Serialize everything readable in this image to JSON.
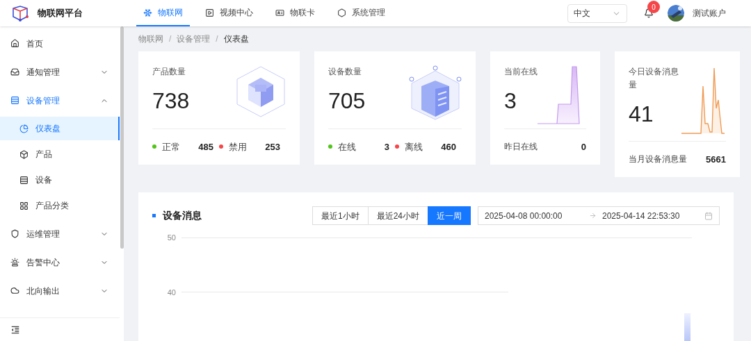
{
  "header": {
    "brand": "物联网平台",
    "nav": [
      {
        "label": "物联网",
        "selected": true
      },
      {
        "label": "视频中心",
        "selected": false
      },
      {
        "label": "物联卡",
        "selected": false
      },
      {
        "label": "系统管理",
        "selected": false
      }
    ],
    "language": "中文",
    "notification_count": "0",
    "user": "测试账户"
  },
  "sidebar": {
    "items": [
      {
        "label": "首页",
        "selected": false
      },
      {
        "label": "通知管理",
        "selected": false,
        "expanded": false
      },
      {
        "label": "设备管理",
        "selected": true,
        "expanded": true,
        "children": [
          {
            "label": "仪表盘",
            "selected": true
          },
          {
            "label": "产品",
            "selected": false
          },
          {
            "label": "设备",
            "selected": false
          },
          {
            "label": "产品分类",
            "selected": false
          }
        ]
      },
      {
        "label": "运维管理",
        "selected": false,
        "expanded": false
      },
      {
        "label": "告警中心",
        "selected": false,
        "expanded": false
      },
      {
        "label": "北向输出",
        "selected": false,
        "expanded": false
      }
    ]
  },
  "breadcrumb": {
    "separator": "/",
    "items": [
      "物联网",
      "设备管理",
      "仪表盘"
    ]
  },
  "cards": [
    {
      "kind": "status",
      "title": "产品数量",
      "value": "738",
      "stats": [
        {
          "label": "正常",
          "value": "485",
          "color": "#52c41a"
        },
        {
          "label": "禁用",
          "value": "253",
          "color": "#f5474a"
        }
      ]
    },
    {
      "kind": "status",
      "title": "设备数量",
      "value": "705",
      "stats": [
        {
          "label": "在线",
          "value": "3",
          "color": "#52c41a"
        },
        {
          "label": "离线",
          "value": "460",
          "color": "#f5474a"
        }
      ]
    },
    {
      "kind": "compare",
      "title": "当前在线",
      "value": "3",
      "footer_label": "昨日在线",
      "footer_value": "0"
    },
    {
      "kind": "compare",
      "title": "今日设备消息量",
      "value": "41",
      "footer_label": "当月设备消息量",
      "footer_value": "5661"
    }
  ],
  "messages": {
    "title": "设备消息",
    "ranges": [
      {
        "label": "最近1小时",
        "selected": false
      },
      {
        "label": "最近24小时",
        "selected": false
      },
      {
        "label": "近一周",
        "selected": true
      }
    ],
    "start": "2025-04-08 00:00:00",
    "end": "2025-04-14 22:53:30",
    "y_labels": [
      "50",
      "40"
    ]
  }
}
